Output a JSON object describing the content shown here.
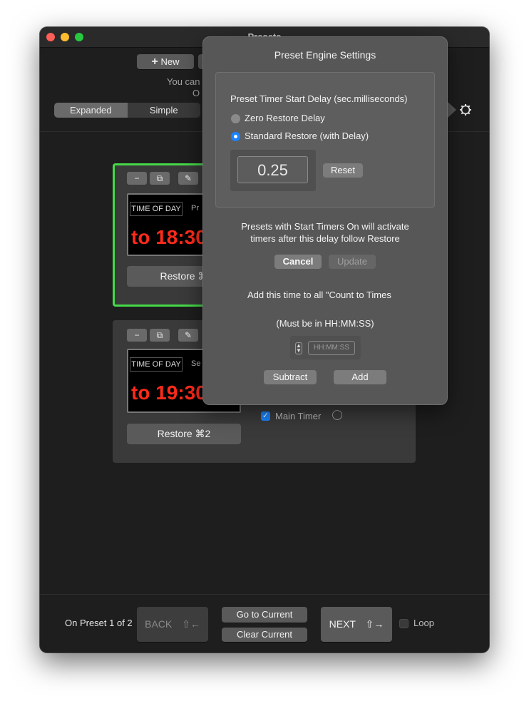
{
  "window": {
    "title": "Presets"
  },
  "toolbar": {
    "new_label": "New",
    "info_line1": "You can",
    "info_line2": "O",
    "view_tabs": [
      "Expanded",
      "Simple"
    ],
    "selected_tab": "Expanded"
  },
  "presets": [
    {
      "display_label": "TIME OF DAY",
      "display_extra": "Pr",
      "time_text": "to 18:30",
      "restore_label": "Restore ⌘",
      "active": true
    },
    {
      "display_label": "TIME OF DAY",
      "display_extra": "Se",
      "time_text": "to 19:30",
      "restore_label": "Restore ⌘2",
      "active": false,
      "main_timer_label": "Main Timer",
      "main_timer_checked": true
    }
  ],
  "popover": {
    "title": "Preset Engine Settings",
    "delay_heading": "Preset Timer Start Delay (sec.milliseconds)",
    "options": [
      "Zero Restore Delay",
      "Standard Restore (with Delay)"
    ],
    "selected_option": "Standard Restore (with Delay)",
    "delay_value": "0.25",
    "reset_label": "Reset",
    "info_line1": "Presets with Start Timers On will activate",
    "info_line2": "timers after this delay follow Restore",
    "cancel_label": "Cancel",
    "update_label": "Update",
    "add_time_line": "Add this time to all \"Count to Times",
    "format_hint": "(Must be in HH:MM:SS)",
    "time_placeholder": "HH:MM:SS",
    "subtract_label": "Subtract",
    "add_label": "Add"
  },
  "footer": {
    "status": "On Preset 1 of 2",
    "back_label": "BACK",
    "back_shortcut": "⇧←",
    "go_current_label": "Go to Current",
    "clear_current_label": "Clear Current",
    "next_label": "NEXT",
    "next_shortcut": "⇧→",
    "loop_label": "Loop"
  },
  "colors": {
    "active_outline": "#46d84a",
    "time_red": "#ff2a1a",
    "radio_accent": "#1a84ff"
  }
}
